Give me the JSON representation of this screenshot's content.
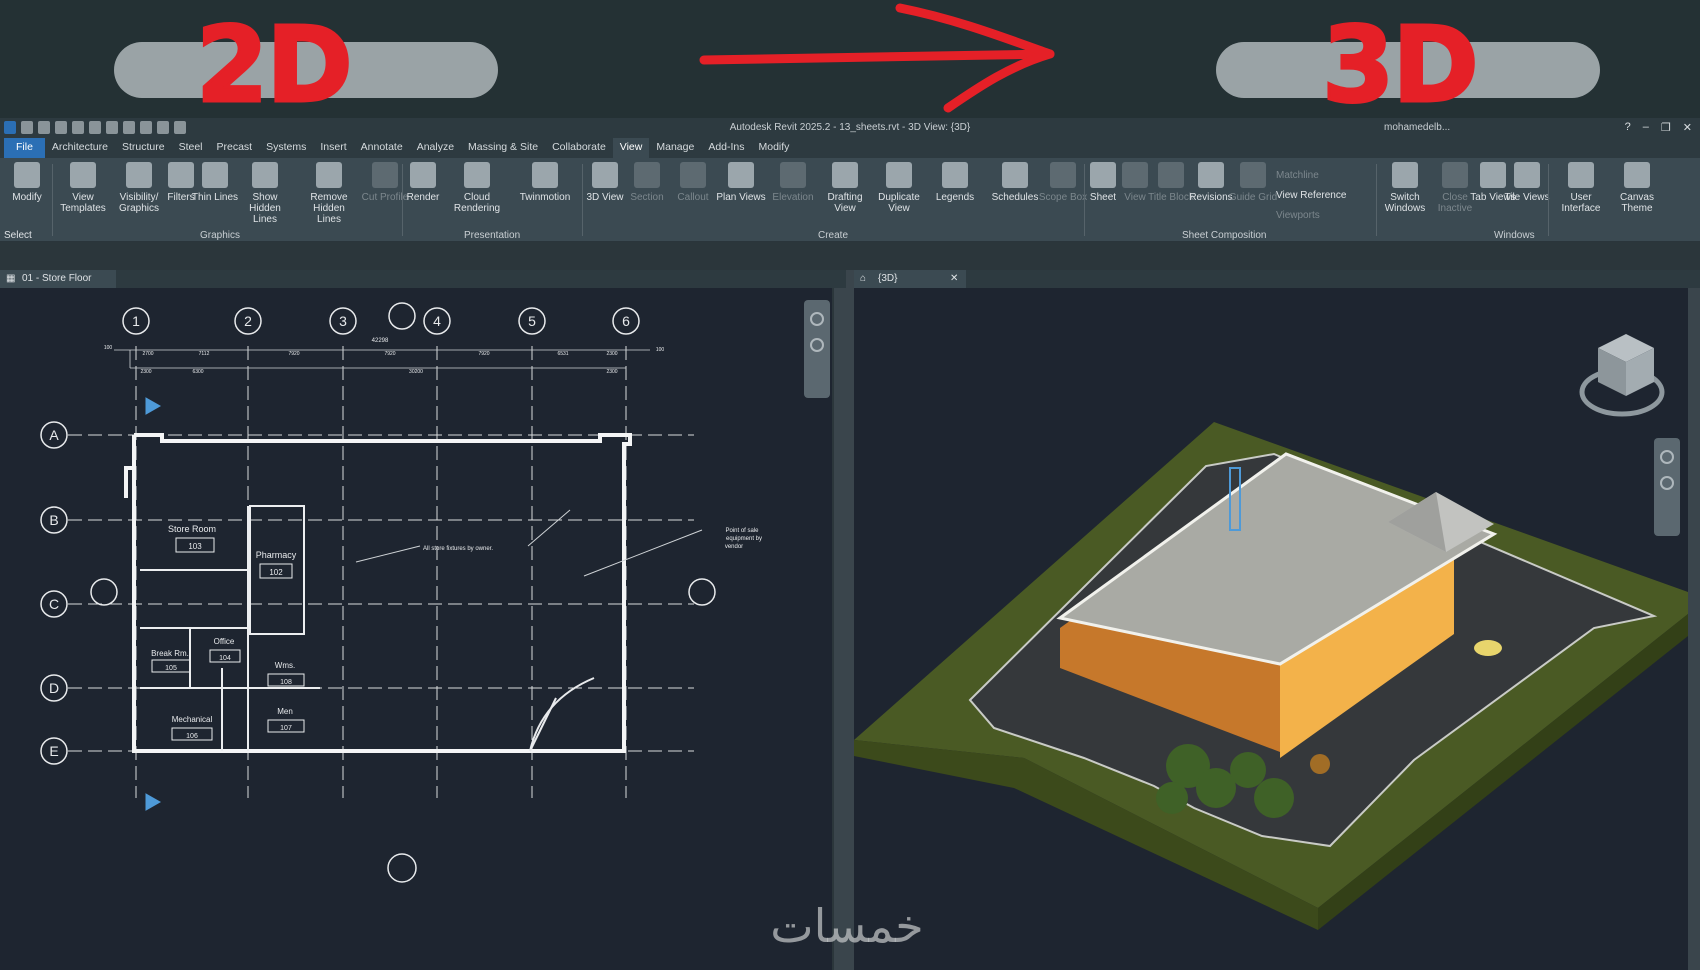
{
  "banner": {
    "left_label": "2D",
    "right_label": "3D"
  },
  "titlebar": {
    "title": "Autodesk Revit 2025.2 - 13_sheets.rvt - 3D View: {3D}",
    "user": "mohamedelb..."
  },
  "tabs": [
    "File",
    "Architecture",
    "Structure",
    "Steel",
    "Precast",
    "Systems",
    "Insert",
    "Annotate",
    "Analyze",
    "Massing & Site",
    "Collaborate",
    "View",
    "Manage",
    "Add-Ins",
    "Modify"
  ],
  "active_tab": "View",
  "ribbon": {
    "select_label": "Select",
    "buttons": {
      "modify": "Modify",
      "view_templates": "View Templates",
      "visibility_graphics": "Visibility/ Graphics",
      "filters": "Filters",
      "thin_lines": "Thin Lines",
      "show_hidden_lines": "Show Hidden Lines",
      "remove_hidden_lines": "Remove Hidden Lines",
      "cut_profile": "Cut Profile",
      "render": "Render",
      "cloud_rendering": "Cloud Rendering",
      "twinmotion": "Twinmotion",
      "view_3d": "3D View",
      "section": "Section",
      "callout": "Callout",
      "plan_views": "Plan Views",
      "elevation": "Elevation",
      "drafting_view": "Drafting View",
      "duplicate_view": "Duplicate View",
      "legends": "Legends",
      "schedules": "Schedules",
      "scope_box": "Scope Box",
      "sheet": "Sheet",
      "view": "View",
      "title_block": "Title Block",
      "revisions": "Revisions",
      "guide_grid": "Guide Grid",
      "matchline": "Matchline",
      "view_reference": "View Reference",
      "viewports": "Viewports",
      "switch_windows": "Switch Windows",
      "close_inactive": "Close Inactive",
      "tab_views": "Tab Views",
      "tile_views": "Tile Views",
      "user_interface": "User Interface",
      "canvas_theme": "Canvas Theme"
    },
    "panels": {
      "graphics": "Graphics",
      "presentation": "Presentation",
      "create": "Create",
      "sheet_composition": "Sheet Composition",
      "windows": "Windows"
    }
  },
  "views": {
    "left_tab": "01 - Store Floor",
    "right_tab": "{3D}"
  },
  "plan": {
    "grid_cols": [
      "1",
      "2",
      "3",
      "4",
      "5",
      "6"
    ],
    "grid_rows": [
      "A",
      "B",
      "C",
      "D",
      "E"
    ],
    "overall_dim": "42298",
    "dims_top": [
      "100",
      "2700",
      "7112",
      "7920",
      "7920",
      "7920",
      "6531",
      "2300",
      "100"
    ],
    "dims_second": [
      "2300",
      "6300",
      "30200",
      "2300"
    ],
    "rooms": [
      {
        "name": "Store Room",
        "number": "103"
      },
      {
        "name": "Pharmacy",
        "number": "102"
      },
      {
        "name": "Office",
        "number": "104"
      },
      {
        "name": "Break Rm.",
        "number": "105"
      },
      {
        "name": "Wms.",
        "number": "108"
      },
      {
        "name": "Men",
        "number": "107"
      },
      {
        "name": "Mechanical",
        "number": "106"
      }
    ],
    "note_fixtures": "All store fixtures by owner.",
    "note_sale_1": "Point of sale",
    "note_sale_2": "equipment by",
    "note_sale_3": "vendor"
  },
  "colors": {
    "accent_red": "#e52027",
    "file_tab": "#2b6fb5",
    "canvas": "#1e2530",
    "grass": "#4a5a24",
    "wall_yellow": "#f3b24a"
  },
  "watermark": "خمسات"
}
